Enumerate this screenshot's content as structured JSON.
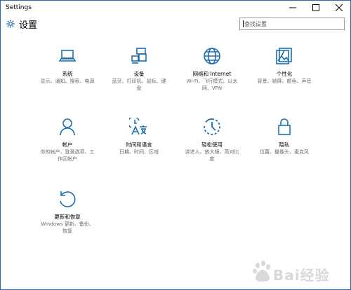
{
  "window": {
    "title": "Settings"
  },
  "header": {
    "title": "设置",
    "search_placeholder": "查找设置"
  },
  "accent": "#1a6fb5",
  "tiles": [
    {
      "icon": "laptop-icon",
      "label": "系统",
      "desc": "显示、通知、搜索、电源"
    },
    {
      "icon": "devices-icon",
      "label": "设备",
      "desc": "蓝牙、打印机、鼠标、键盘"
    },
    {
      "icon": "globe-icon",
      "label": "网络和 Internet",
      "desc": "Wi-Fi、飞行模式、以太网、VPN"
    },
    {
      "icon": "personalization-icon",
      "label": "个性化",
      "desc": "背景、锁屏、颜色、声音"
    },
    {
      "icon": "person-icon",
      "label": "帐户",
      "desc": "你的帐户、登录选项、工作区帐户"
    },
    {
      "icon": "time-language-icon",
      "label": "时间和语言",
      "desc": "日期、时间、区域"
    },
    {
      "icon": "ease-of-access-icon",
      "label": "轻松使用",
      "desc": "讲述人、放大镜、高对比度"
    },
    {
      "icon": "lock-icon",
      "label": "隐私",
      "desc": "位置、摄像头、麦克风"
    },
    {
      "icon": "refresh-icon",
      "label": "更新和恢复",
      "desc": "Windows 更新、备份、恢复"
    }
  ],
  "watermark": {
    "text": "Bai经验"
  }
}
